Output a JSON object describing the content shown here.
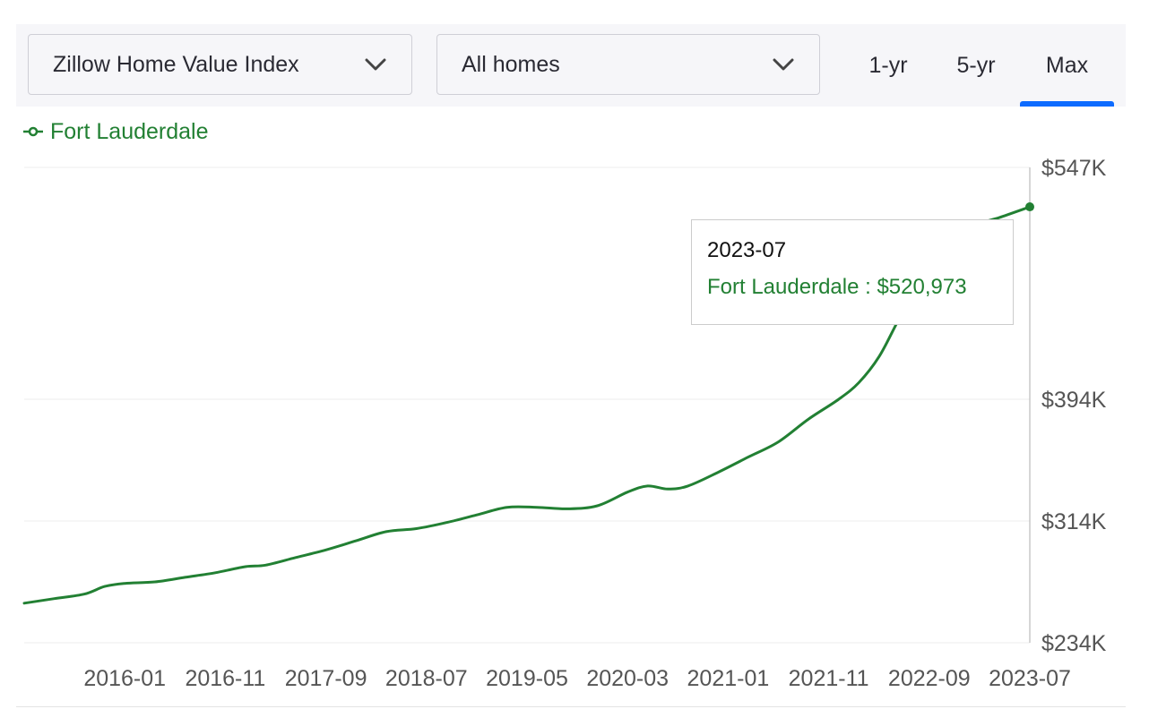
{
  "toolbar": {
    "metric_label": "Zillow Home Value Index",
    "type_label": "All homes",
    "tabs": [
      {
        "label": "1-yr",
        "active": false
      },
      {
        "label": "5-yr",
        "active": false
      },
      {
        "label": "Max",
        "active": true
      }
    ],
    "accent_color": "#0d6bff"
  },
  "legend": {
    "label": "Fort Lauderdale",
    "color": "#228033"
  },
  "tooltip": {
    "date": "2023-07",
    "series_label": "Fort Lauderdale : $520,973"
  },
  "chart_data": {
    "type": "line",
    "y_tick_labels": [
      "$547K",
      "$394K",
      "$314K",
      "$234K"
    ],
    "y_ticks": [
      547,
      394,
      314,
      234
    ],
    "x_tick_labels": [
      "2016-01",
      "2016-11",
      "2017-09",
      "2018-07",
      "2019-05",
      "2020-03",
      "2021-01",
      "2021-11",
      "2022-09",
      "2023-07"
    ],
    "xlim": [
      "2015-03",
      "2023-07"
    ],
    "ylim": [
      234,
      547
    ],
    "y_unit": "thousands USD",
    "grid": true,
    "legend_position": "top-left",
    "series": [
      {
        "name": "Fort Lauderdale",
        "color": "#228033",
        "points": [
          [
            "2015-03",
            260
          ],
          [
            "2015-06",
            263
          ],
          [
            "2015-09",
            266
          ],
          [
            "2015-11",
            271
          ],
          [
            "2016-01",
            273
          ],
          [
            "2016-04",
            274
          ],
          [
            "2016-07",
            277
          ],
          [
            "2016-10",
            280
          ],
          [
            "2017-01",
            284
          ],
          [
            "2017-03",
            285
          ],
          [
            "2017-06",
            290
          ],
          [
            "2017-09",
            295
          ],
          [
            "2017-12",
            301
          ],
          [
            "2018-03",
            307
          ],
          [
            "2018-06",
            309
          ],
          [
            "2018-09",
            313
          ],
          [
            "2018-12",
            318
          ],
          [
            "2019-03",
            323
          ],
          [
            "2019-06",
            323
          ],
          [
            "2019-09",
            322
          ],
          [
            "2019-12",
            324
          ],
          [
            "2020-03",
            333
          ],
          [
            "2020-05",
            337
          ],
          [
            "2020-07",
            335
          ],
          [
            "2020-09",
            337
          ],
          [
            "2020-12",
            346
          ],
          [
            "2021-03",
            356
          ],
          [
            "2021-06",
            366
          ],
          [
            "2021-09",
            381
          ],
          [
            "2021-12",
            394
          ],
          [
            "2022-02",
            405
          ],
          [
            "2022-04",
            422
          ],
          [
            "2022-06",
            447
          ],
          [
            "2022-08",
            470
          ],
          [
            "2022-10",
            490
          ],
          [
            "2022-12",
            503
          ],
          [
            "2023-02",
            510
          ],
          [
            "2023-04",
            514
          ],
          [
            "2023-07",
            520.973
          ]
        ]
      }
    ]
  }
}
